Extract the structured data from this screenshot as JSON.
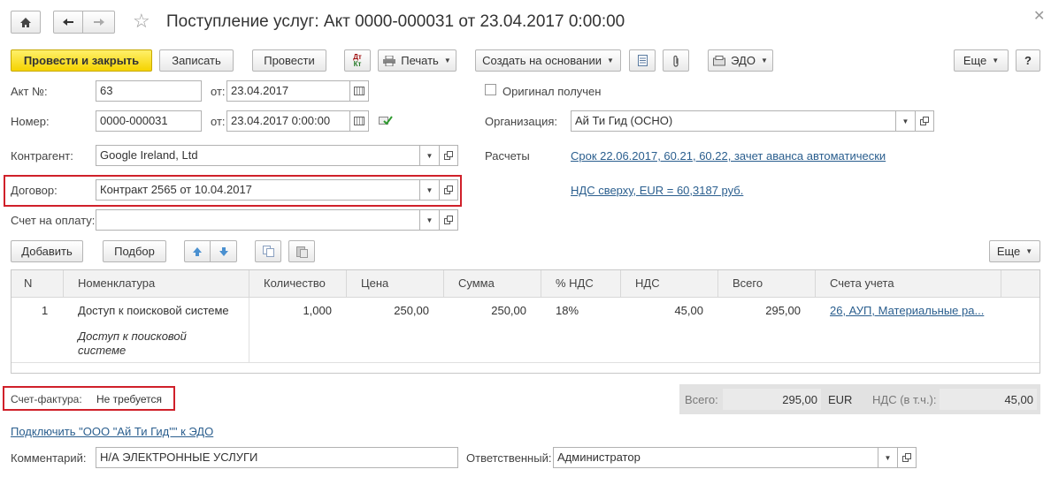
{
  "title": "Поступление услуг: Акт 0000-000031 от 23.04.2017 0:00:00",
  "toolbar": {
    "post_close": "Провести и закрыть",
    "save": "Записать",
    "post": "Провести",
    "print": "Печать",
    "create_based": "Создать на основании",
    "edo": "ЭДО",
    "more": "Еще",
    "help": "?"
  },
  "form": {
    "act_no_label": "Акт №:",
    "act_no": "63",
    "from_label": "от:",
    "act_date": "23.04.2017",
    "number_label": "Номер:",
    "number": "0000-000031",
    "number_date": "23.04.2017  0:00:00",
    "original_label": "Оригинал получен",
    "org_label": "Организация:",
    "org": "Ай Ти Гид (ОСНО)",
    "counterparty_label": "Контрагент:",
    "counterparty": "Google Ireland, Ltd",
    "settlements_label": "Расчеты",
    "settlements_link": "Срок 22.06.2017, 60.21, 60.22, зачет аванса автоматически",
    "contract_label": "Договор:",
    "contract": "Контракт 2565 от 10.04.2017",
    "vat_link": "НДС сверху, EUR = 60,3187 руб.",
    "invoice_label": "Счет на оплату:",
    "invoice": ""
  },
  "table_toolbar": {
    "add": "Добавить",
    "pick": "Подбор",
    "more": "Еще"
  },
  "table": {
    "headers": [
      "N",
      "Номенклатура",
      "Количество",
      "Цена",
      "Сумма",
      "% НДС",
      "НДС",
      "Всего",
      "Счета учета"
    ],
    "rows": [
      {
        "n": "1",
        "name": "Доступ к поисковой системе",
        "content_1": "Доступ к поисковой",
        "content_2": "системе",
        "qty": "1,000",
        "price": "250,00",
        "sum": "250,00",
        "vat_rate": "18%",
        "vat": "45,00",
        "total": "295,00",
        "accounts": "26, АУП, Материальные ра..."
      }
    ]
  },
  "footer": {
    "sf_label": "Счет-фактура:",
    "sf_value": "Не требуется",
    "total_label": "Всего:",
    "total_value": "295,00",
    "currency": "EUR",
    "vat_incl_label": "НДС (в т.ч.):",
    "vat_incl_value": "45,00",
    "connect_edo_link": "Подключить \"ООО \"Ай Ти Гид\"\" к ЭДО",
    "comment_label": "Комментарий:",
    "comment": "Н/А ЭЛЕКТРОННЫЕ УСЛУГИ",
    "responsible_label": "Ответственный:",
    "responsible": "Администратор"
  },
  "colors": {
    "accent_yellow": "#f5d300",
    "highlight_red": "#d0202a",
    "link_blue": "#2a5e8e"
  }
}
